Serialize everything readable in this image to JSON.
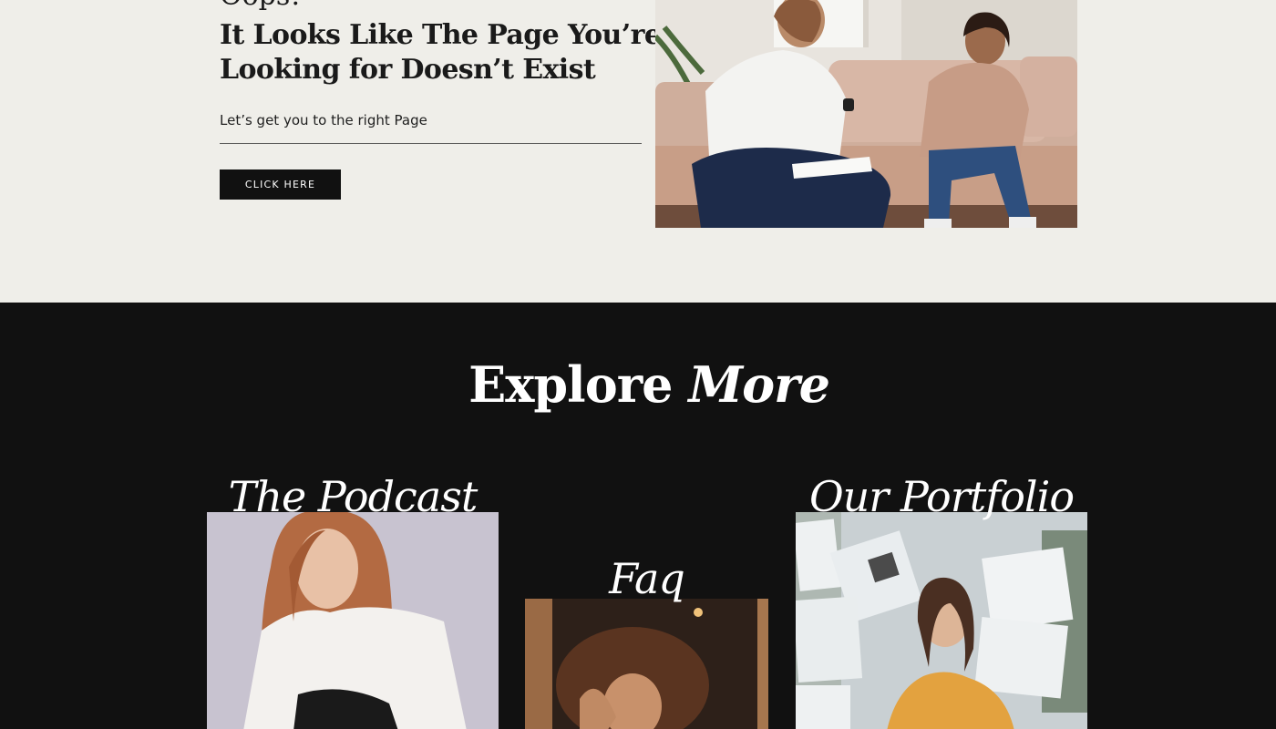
{
  "hero": {
    "oops": "Oops!",
    "headline_line1": "It Looks Like The Page You’re",
    "headline_line2": "Looking for Doesn’t Exist",
    "subtext": "Let’s get you to the right Page",
    "cta_label": "CLICK HERE"
  },
  "explore": {
    "title_plain": "Explore",
    "title_italic": "More",
    "cards": [
      {
        "label": "The Podcast"
      },
      {
        "label": "Faq"
      },
      {
        "label": "Our Portfolio"
      }
    ]
  },
  "colors": {
    "page_light": "#efeee9",
    "page_dark": "#111111",
    "button_bg": "#111111",
    "text_dark": "#1a1a1a",
    "text_light": "#ffffff"
  }
}
